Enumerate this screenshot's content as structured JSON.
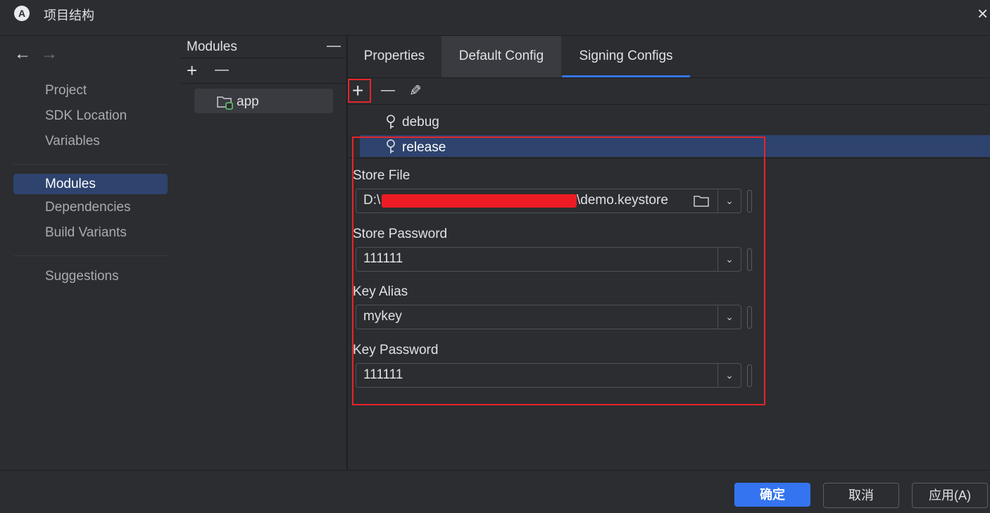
{
  "window": {
    "title": "项目结构",
    "close_icon": "×"
  },
  "nav": {
    "back_icon": "←",
    "forward_icon": "→",
    "items": [
      {
        "label": "Project"
      },
      {
        "label": "SDK Location"
      },
      {
        "label": "Variables"
      },
      {
        "label": "Modules"
      },
      {
        "label": "Dependencies"
      },
      {
        "label": "Build Variants"
      },
      {
        "label": "Suggestions"
      }
    ],
    "selected": "Modules"
  },
  "modules": {
    "header": "Modules",
    "collapse_icon": "—",
    "add_icon": "+",
    "remove_icon": "—",
    "items": [
      {
        "label": "app"
      }
    ]
  },
  "tabs": [
    {
      "label": "Properties"
    },
    {
      "label": "Default Config"
    },
    {
      "label": "Signing Configs"
    }
  ],
  "active_tab": "Signing Configs",
  "signing": {
    "toolbar": {
      "add_icon": "+",
      "remove_icon": "—",
      "edit_icon": "✎"
    },
    "configs": [
      {
        "label": "debug"
      },
      {
        "label": "release"
      }
    ],
    "selected": "release",
    "fields": {
      "store_file": {
        "label": "Store File",
        "value_prefix": "D:\\",
        "value_suffix": "\\demo.keystore"
      },
      "store_password": {
        "label": "Store Password",
        "value": "111111"
      },
      "key_alias": {
        "label": "Key Alias",
        "value": "mykey"
      },
      "key_password": {
        "label": "Key Password",
        "value": "111111"
      }
    }
  },
  "footer": {
    "ok": "确定",
    "cancel": "取消",
    "apply": "应用(A)"
  },
  "colors": {
    "accent": "#3574f0",
    "selected_bg": "#2e436e",
    "annotation": "#e5252a",
    "redaction": "#ed1c24"
  }
}
